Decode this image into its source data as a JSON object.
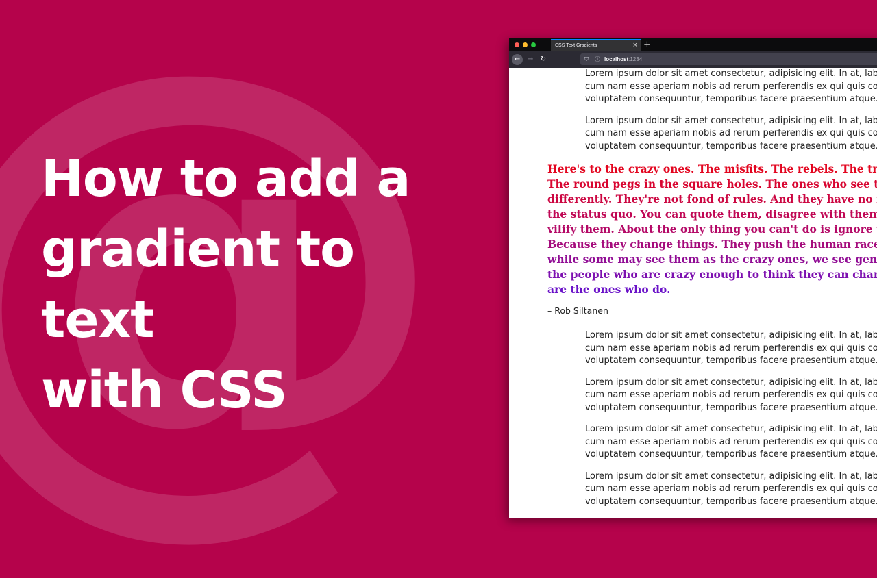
{
  "headline": {
    "line1": "How to add a",
    "line2": "gradient to text",
    "line3": "with CSS"
  },
  "background_glyph": "@",
  "browser": {
    "tab_title": "CSS Text Gradients",
    "url_host": "localhost",
    "url_port": ":1234",
    "lorem_lines": [
      "Lorem ipsum dolor sit amet consectetur, adipisicing elit. In at, labore eiu",
      "cum nam esse aperiam nobis ad rerum perferendis ex qui quis corrupti",
      "voluptatem consequuntur, temporibus facere praesentium atque."
    ],
    "quote_lines": [
      {
        "text": "Here's to the crazy ones. The misfits. The rebels. The trouble",
        "color": "#e3051f"
      },
      {
        "text": "The round pegs in the square holes. The ones who see things",
        "color": "#d80530"
      },
      {
        "text": "differently. They're not fond of rules. And they have no respe",
        "color": "#cc0641"
      },
      {
        "text": "the status quo. You can quote them, disagree with them, glor",
        "color": "#c00754"
      },
      {
        "text": "vilify them. About the only thing you can't do is ignore them",
        "color": "#b40967"
      },
      {
        "text": "Because they change things. They push the human race forw",
        "color": "#a50b7c"
      },
      {
        "text": "while some may see them as the crazy ones, we see genius. B",
        "color": "#910d95"
      },
      {
        "text": "the people who are crazy enough to think they can change th",
        "color": "#7d10b0"
      },
      {
        "text": "are the ones who do.",
        "color": "#6a12c8"
      }
    ],
    "attribution": "– Rob Siltanen"
  }
}
